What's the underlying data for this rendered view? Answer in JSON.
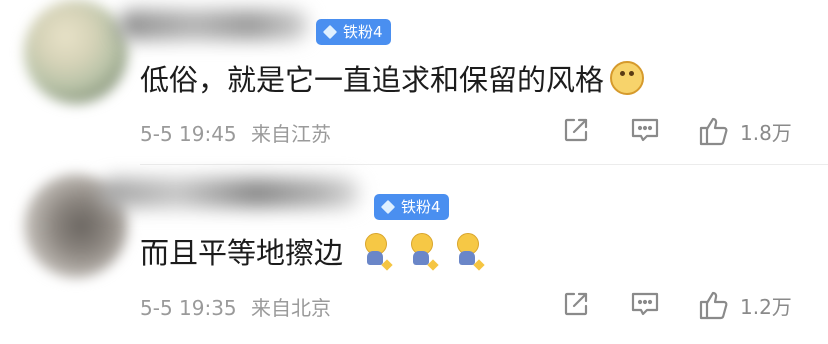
{
  "comments": [
    {
      "badge": "铁粉4",
      "text": "低俗，就是它一直追求和保留的风格",
      "emojis": [
        "doge-emoji"
      ],
      "time": "5-5 19:45",
      "location": "来自江苏",
      "likes": "1.8万"
    },
    {
      "badge": "铁粉4",
      "text": "而且平等地擦边",
      "emojis": [
        "sit-emoji",
        "sit-emoji",
        "sit-emoji"
      ],
      "time": "5-5 19:35",
      "location": "来自北京",
      "likes": "1.2万"
    }
  ],
  "colors": {
    "badge": "#4a8ff0",
    "meta": "#9a9a9a",
    "text": "#1c1c1c"
  }
}
